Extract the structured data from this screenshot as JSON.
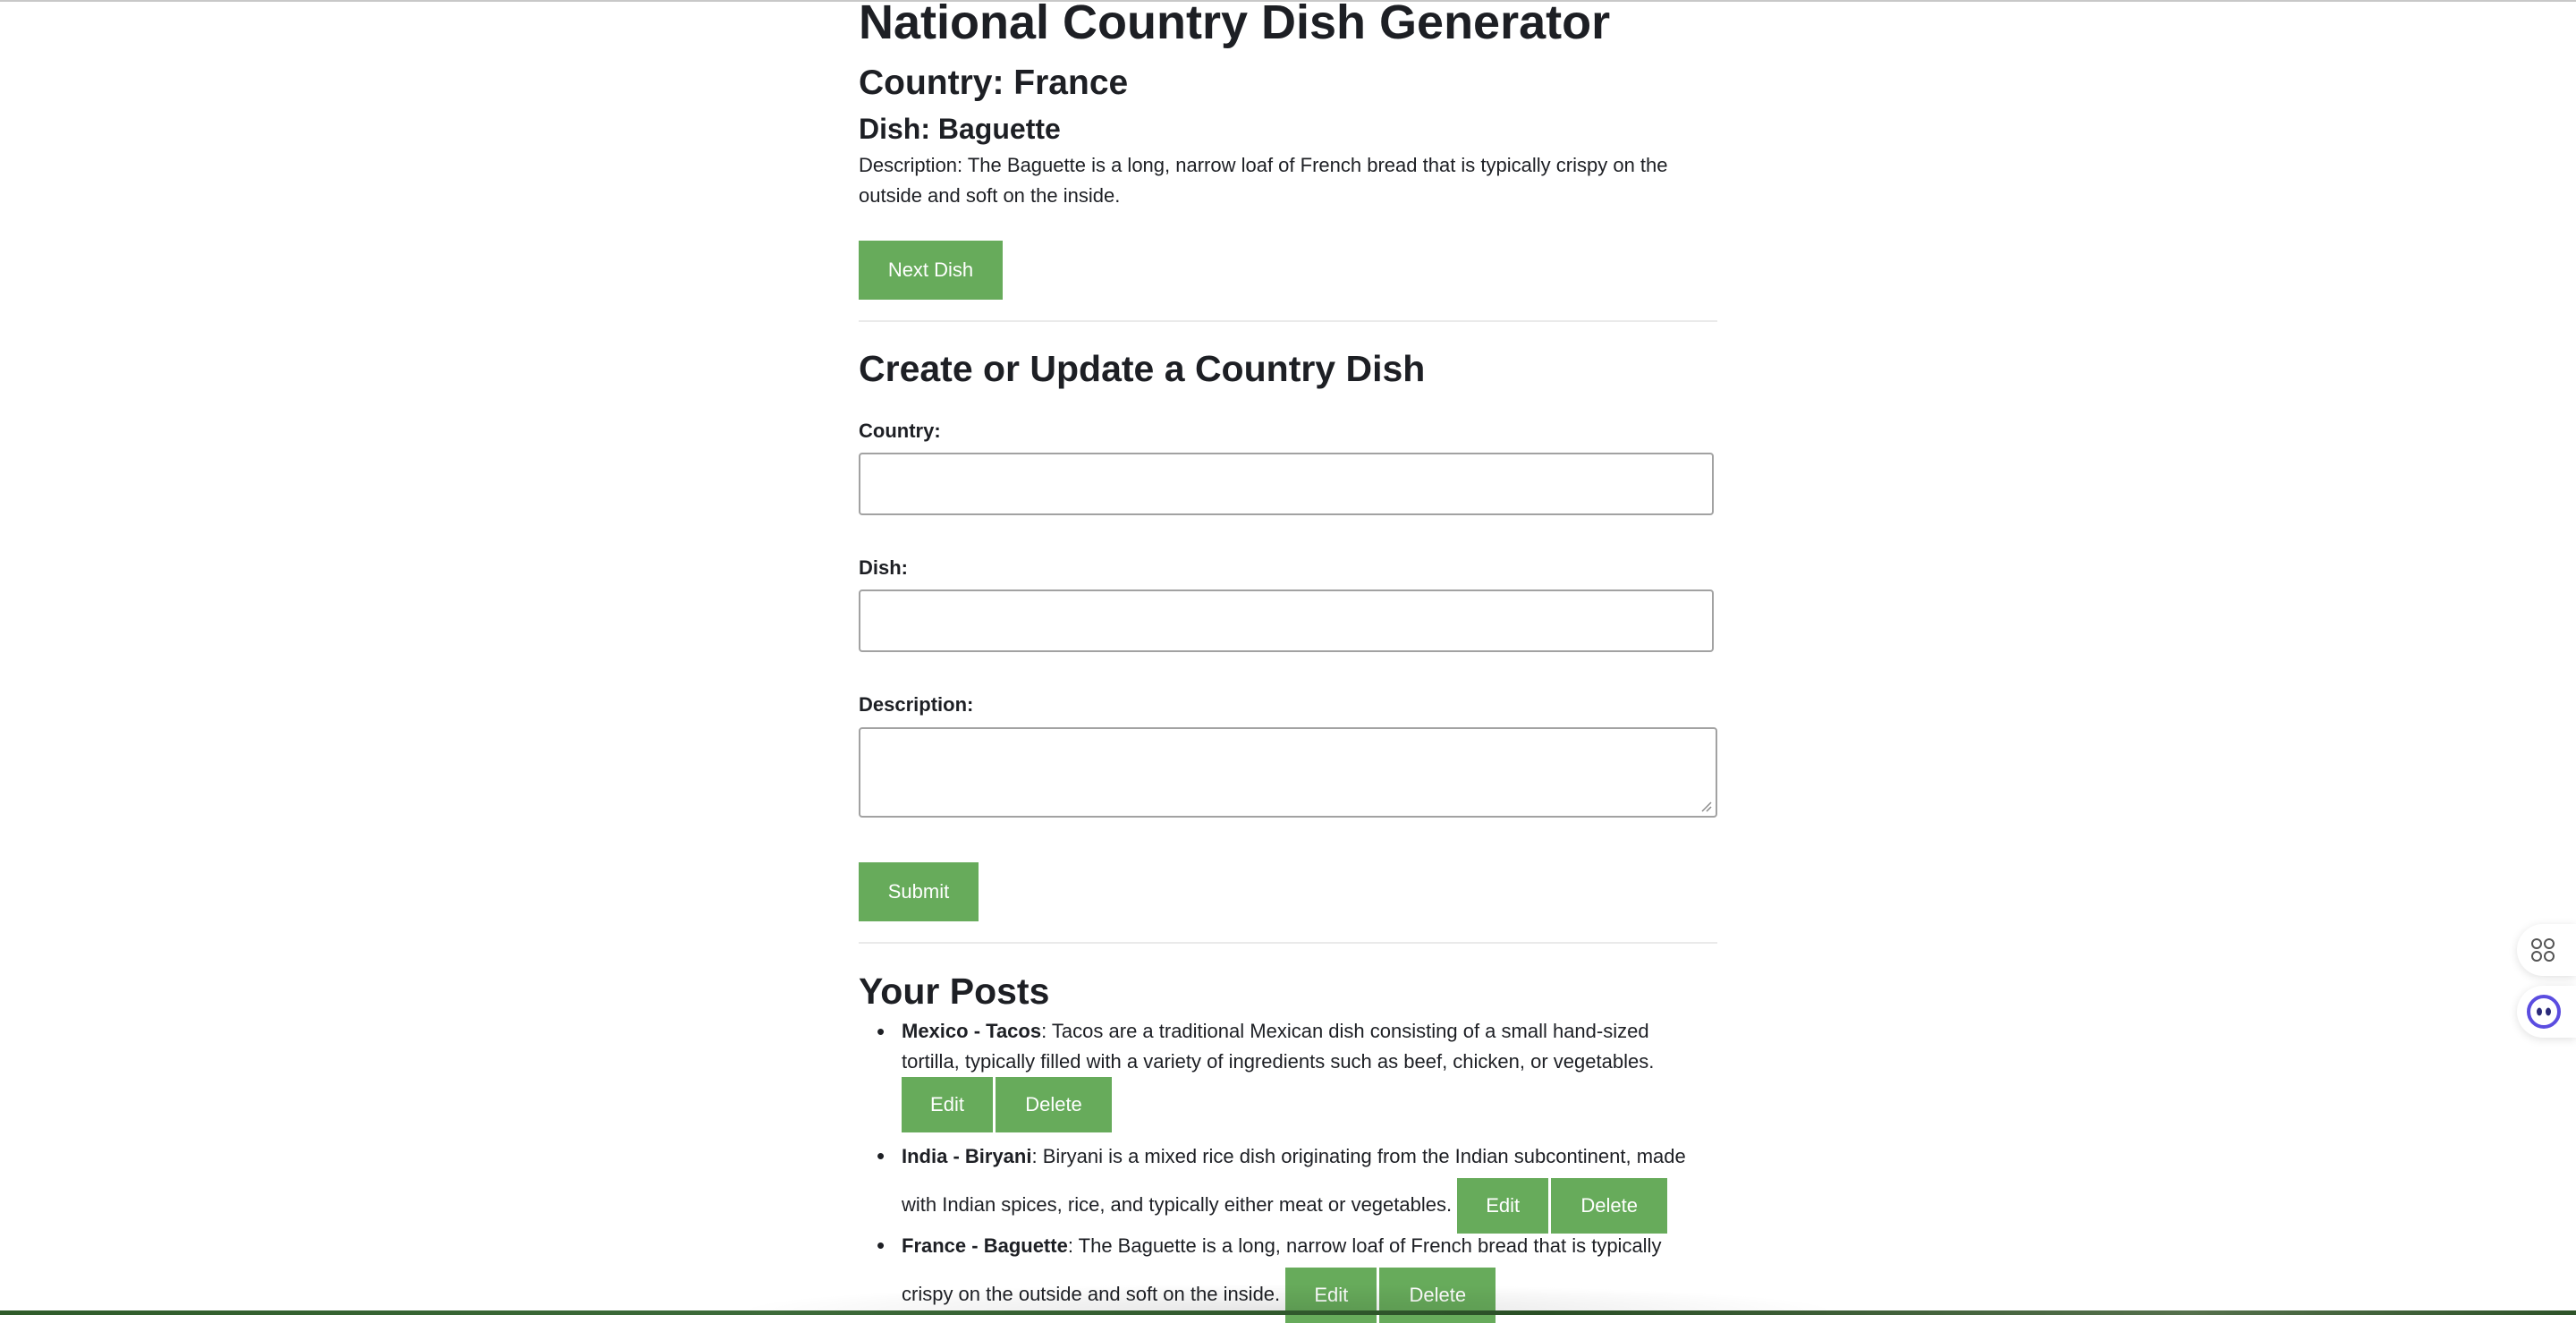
{
  "generator": {
    "title": "National Country Dish Generator",
    "country_line": "Country: France",
    "dish_line": "Dish: Baguette",
    "description": "Description: The Baguette is a long, narrow loaf of French bread that is typically crispy on the outside and soft on the inside.",
    "next_label": "Next Dish"
  },
  "form": {
    "title": "Create or Update a Country Dish",
    "country_label": "Country:",
    "country_value": "",
    "dish_label": "Dish:",
    "dish_value": "",
    "description_label": "Description:",
    "description_value": "",
    "submit_label": "Submit"
  },
  "posts": {
    "title": "Your Posts",
    "edit_label": "Edit",
    "delete_label": "Delete",
    "items": [
      {
        "head": "Mexico - Tacos",
        "text": ": Tacos are a traditional Mexican dish consisting of a small hand-sized tortilla, typically filled with a variety of ingredients such as beef, chicken, or vegetables."
      },
      {
        "head": "India - Biryani",
        "text": ": Biryani is a mixed rice dish originating from the Indian subcontinent, made with Indian spices, rice, and typically either meat or vegetables."
      },
      {
        "head": "France - Baguette",
        "text": ": The Baguette is a long, narrow loaf of French bread that is typically crispy on the outside and soft on the inside."
      }
    ]
  },
  "side_widgets": {
    "top_icon": "apps-grid-icon",
    "bottom_icon": "assistant-face-icon"
  },
  "colors": {
    "button": "#67ab5b",
    "text": "#1d1f24"
  }
}
